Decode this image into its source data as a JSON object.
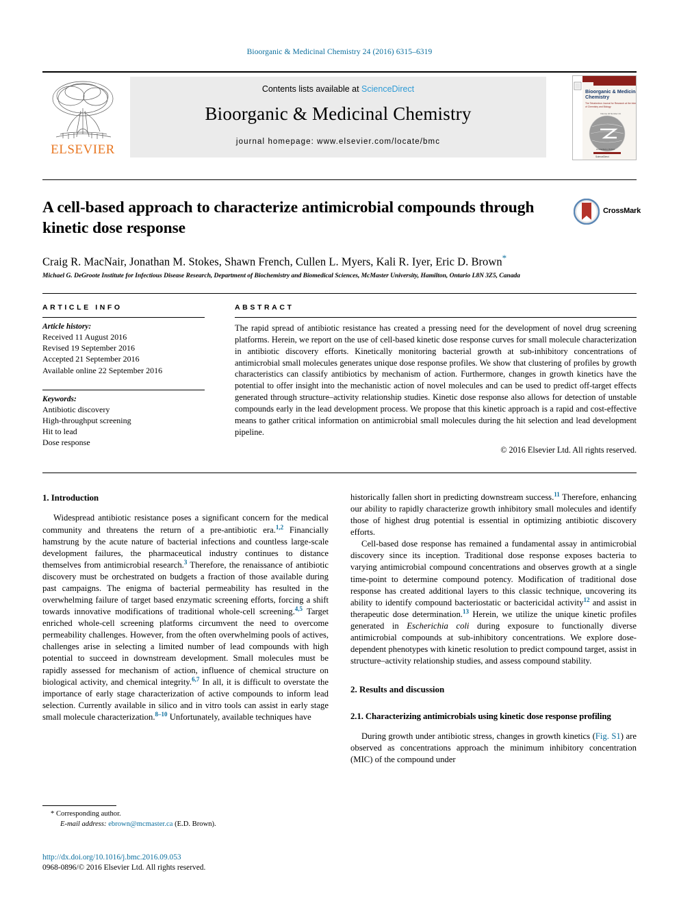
{
  "running_head": "Bioorganic & Medicinal Chemistry 24 (2016) 6315–6319",
  "masthead": {
    "publisher": "ELSEVIER",
    "contents_prefix": "Contents lists available at ",
    "sciencedirect": "ScienceDirect",
    "journal_name": "Bioorganic & Medicinal Chemistry",
    "homepage": "journal homepage: www.elsevier.com/locate/bmc",
    "cover_title": "Bioorganic & Medicinal Chemistry"
  },
  "article": {
    "title": "A cell-based approach to characterize antimicrobial compounds through kinetic dose response",
    "crossmark_label": "CrossMark",
    "authors": "Craig R. MacNair, Jonathan M. Stokes, Shawn French, Cullen L. Myers, Kali R. Iyer, Eric D. Brown",
    "corresponding_marker": "*",
    "affiliation": "Michael G. DeGroote Institute for Infectious Disease Research, Department of Biochemistry and Biomedical Sciences, McMaster University, Hamilton, Ontario L8N 3Z5, Canada"
  },
  "article_info": {
    "heading": "ARTICLE INFO",
    "history_label": "Article history:",
    "history": [
      "Received 11 August 2016",
      "Revised 19 September 2016",
      "Accepted 21 September 2016",
      "Available online 22 September 2016"
    ],
    "keywords_label": "Keywords:",
    "keywords": [
      "Antibiotic discovery",
      "High-throughput screening",
      "Hit to lead",
      "Dose response"
    ]
  },
  "abstract": {
    "heading": "ABSTRACT",
    "text": "The rapid spread of antibiotic resistance has created a pressing need for the development of novel drug screening platforms. Herein, we report on the use of cell-based kinetic dose response curves for small molecule characterization in antibiotic discovery efforts. Kinetically monitoring bacterial growth at sub-inhibitory concentrations of antimicrobial small molecules generates unique dose response profiles. We show that clustering of profiles by growth characteristics can classify antibiotics by mechanism of action. Furthermore, changes in growth kinetics have the potential to offer insight into the mechanistic action of novel molecules and can be used to predict off-target effects generated through structure–activity relationship studies. Kinetic dose response also allows for detection of unstable compounds early in the lead development process. We propose that this kinetic approach is a rapid and cost-effective means to gather critical information on antimicrobial small molecules during the hit selection and lead development pipeline.",
    "copyright": "© 2016 Elsevier Ltd. All rights reserved."
  },
  "sections": {
    "intro_heading": "1. Introduction",
    "results_heading": "2. Results and discussion",
    "subsection_heading": "2.1. Characterizing antimicrobials using kinetic dose response profiling"
  },
  "body": {
    "left_p1_a": "Widespread antibiotic resistance poses a significant concern for the medical community and threatens the return of a pre-antibiotic era.",
    "left_p1_cite1": "1,2",
    "left_p1_b": " Financially hamstrung by the acute nature of bacterial infections and countless large-scale development failures, the pharmaceutical industry continues to distance themselves from antimicrobial research.",
    "left_p1_cite2": "3",
    "left_p1_c": " Therefore, the renaissance of antibiotic discovery must be orchestrated on budgets a fraction of those available during past campaigns. The enigma of bacterial permeability has resulted in the overwhelming failure of target based enzymatic screening efforts, forcing a shift towards innovative modifications of traditional whole-cell screening.",
    "left_p1_cite3": "4,5",
    "left_p1_d": " Target enriched whole-cell screening platforms circumvent the need to overcome permeability challenges. However, from the often overwhelming pools of actives, challenges arise in selecting a limited number of lead compounds with high potential to succeed in downstream development. Small molecules must be rapidly assessed for mechanism of action, influence of chemical structure on biological activity, and chemical integrity.",
    "left_p1_cite4": "6,7",
    "left_p1_e": " In all, it is difficult to overstate the importance of early stage characterization of active compounds to inform lead selection. Currently available in silico and in vitro tools can assist in early stage small molecule characterization.",
    "left_p1_cite5": "8–10",
    "left_p1_f": " Unfortunately, available techniques have",
    "right_p1_a": "historically fallen short in predicting downstream success.",
    "right_p1_cite1": "11",
    "right_p1_b": " Therefore, enhancing our ability to rapidly characterize growth inhibitory small molecules and identify those of highest drug potential is essential in optimizing antibiotic discovery efforts.",
    "right_p2_a": "Cell-based dose response has remained a fundamental assay in antimicrobial discovery since its inception. Traditional dose response exposes bacteria to varying antimicrobial compound concentrations and observes growth at a single time-point to determine compound potency. Modification of traditional dose response has created additional layers to this classic technique, uncovering its ability to identify compound bacteriostatic or bactericidal activity",
    "right_p2_cite1": "12",
    "right_p2_b": " and assist in therapeutic dose determination.",
    "right_p2_cite2": "13",
    "right_p2_c": " Herein, we utilize the unique kinetic profiles generated in ",
    "right_p2_italic": "Escherichia coli",
    "right_p2_d": " during exposure to functionally diverse antimicrobial compounds at sub-inhibitory concentrations. We explore dose-dependent phenotypes with kinetic resolution to predict compound target, assist in structure–activity relationship studies, and assess compound stability.",
    "right_p3_a": "During growth under antibiotic stress, changes in growth kinetics (",
    "right_p3_figref": "Fig. S1",
    "right_p3_b": ") are observed as concentrations approach the minimum inhibitory concentration (MIC) of the compound under"
  },
  "footnote": {
    "corresponding_star": "*",
    "corresponding_text": "Corresponding author.",
    "email_label": "E-mail address:",
    "email": "ebrown@mcmaster.ca",
    "email_owner": "(E.D. Brown).",
    "doi": "http://dx.doi.org/10.1016/j.bmc.2016.09.053",
    "issn_line": "0968-0896/© 2016 Elsevier Ltd. All rights reserved."
  },
  "colors": {
    "link_blue": "#0b6e9d",
    "sciencedirect_blue": "#2e9bd6",
    "elsevier_orange": "#e87722",
    "crossmark_red": "#b4332a"
  }
}
